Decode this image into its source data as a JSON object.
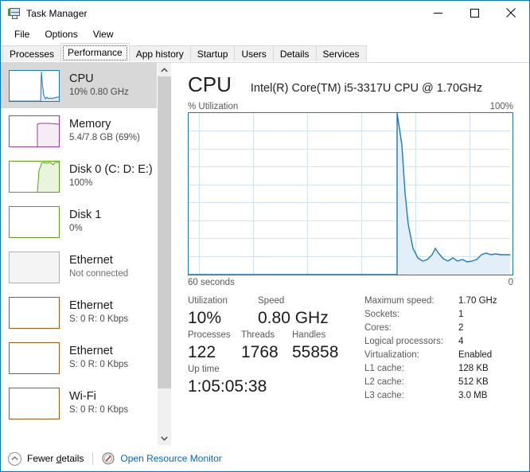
{
  "window": {
    "title": "Task Manager",
    "icon": "task-manager-icon",
    "controls": {
      "minimize": "Minimize",
      "maximize": "Maximize",
      "close": "Close"
    }
  },
  "menu": {
    "items": [
      "File",
      "Options",
      "View"
    ]
  },
  "tabs": {
    "items": [
      "Processes",
      "Performance",
      "App history",
      "Startup",
      "Users",
      "Details",
      "Services"
    ],
    "selected": "Performance"
  },
  "sidebar": {
    "items": [
      {
        "title": "CPU",
        "sub": "10%  0.80 GHz",
        "color": "#1a7bbd",
        "selected": true,
        "connected": true
      },
      {
        "title": "Memory",
        "sub": "5.4/7.8 GB (69%)",
        "color": "#a437a4",
        "selected": false,
        "connected": true
      },
      {
        "title": "Disk 0 (C: D: E:)",
        "sub": "100%",
        "color": "#59a314",
        "selected": false,
        "connected": true
      },
      {
        "title": "Disk 1",
        "sub": "0%",
        "color": "#59a314",
        "selected": false,
        "connected": true
      },
      {
        "title": "Ethernet",
        "sub": "Not connected",
        "color": "#b0b0b0",
        "selected": false,
        "connected": false
      },
      {
        "title": "Ethernet",
        "sub": "S: 0 R: 0 Kbps",
        "color": "#a45a10",
        "selected": false,
        "connected": true
      },
      {
        "title": "Ethernet",
        "sub": "S: 0 R: 0 Kbps",
        "color": "#a45a10",
        "selected": false,
        "connected": true
      },
      {
        "title": "Wi-Fi",
        "sub": "S: 0 R: 0 Kbps",
        "color": "#a45a10",
        "selected": false,
        "connected": true
      }
    ]
  },
  "main": {
    "title": "CPU",
    "subtitle": "Intel(R) Core(TM) i5-3317U CPU @ 1.70GHz",
    "axis_label": "% Utilization",
    "axis_max": "100%",
    "time_left": "60 seconds",
    "time_right": "0",
    "stats": {
      "row1": [
        {
          "label": "Utilization",
          "value": "10%"
        },
        {
          "label": "Speed",
          "value": "0.80 GHz"
        }
      ],
      "row2": [
        {
          "label": "Processes",
          "value": "122"
        },
        {
          "label": "Threads",
          "value": "1768"
        },
        {
          "label": "Handles",
          "value": "55858"
        }
      ],
      "row3": [
        {
          "label": "Up time",
          "value": "1:05:05:38"
        }
      ]
    },
    "specs": [
      {
        "key": "Maximum speed:",
        "value": "1.70 GHz"
      },
      {
        "key": "Sockets:",
        "value": "1"
      },
      {
        "key": "Cores:",
        "value": "2"
      },
      {
        "key": "Logical processors:",
        "value": "4"
      },
      {
        "key": "Virtualization:",
        "value": "Enabled"
      },
      {
        "key": "L1 cache:",
        "value": "128 KB"
      },
      {
        "key": "L2 cache:",
        "value": "512 KB"
      },
      {
        "key": "L3 cache:",
        "value": "3.0 MB"
      }
    ]
  },
  "chart_data": {
    "type": "area",
    "title": "CPU % Utilization",
    "xlabel": "60 seconds",
    "ylabel": "% Utilization",
    "ylim": [
      0,
      100
    ],
    "xlim": [
      0,
      60
    ],
    "grid": true,
    "line_color": "#1a7bbd",
    "fill_color": "#dceaf5",
    "note": "No history before ~39s; sharp spike to 100% then settles near 8-12%",
    "x": [
      0,
      39,
      40,
      41,
      42,
      43,
      44,
      45,
      46,
      47,
      48,
      49,
      50,
      51,
      52,
      53,
      54,
      55,
      56,
      57,
      58,
      59,
      60
    ],
    "values": [
      0,
      0,
      100,
      52,
      18,
      9,
      6,
      5,
      7,
      14,
      10,
      7,
      8,
      6,
      9,
      6,
      7,
      7,
      8,
      9,
      12,
      11,
      11
    ]
  },
  "footer": {
    "fewer_details": "Fewer details",
    "fewer_details_accesskey": "d",
    "resource_monitor": "Open Resource Monitor",
    "link_color": "#0066cc"
  }
}
